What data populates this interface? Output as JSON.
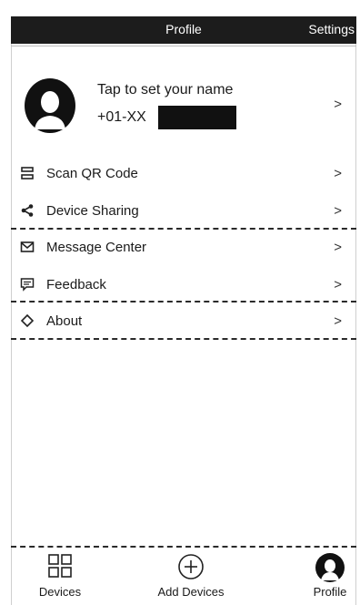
{
  "header": {
    "title": "Profile",
    "settings_label": "Settings"
  },
  "profile": {
    "name_prompt": "Tap to set your name",
    "phone_prefix": "+01-XX",
    "chevron": ">"
  },
  "menu": [
    {
      "label": "Scan QR Code",
      "icon": "scan-qr-icon",
      "chevron": ">"
    },
    {
      "label": "Device Sharing",
      "icon": "share-icon",
      "chevron": ">"
    },
    {
      "label": "Message Center",
      "icon": "mail-icon",
      "chevron": ">"
    },
    {
      "label": "Feedback",
      "icon": "feedback-icon",
      "chevron": ">"
    },
    {
      "label": "About",
      "icon": "about-icon",
      "chevron": ">"
    }
  ],
  "bottom_nav": {
    "items": [
      {
        "label": "Devices",
        "icon": "grid-icon"
      },
      {
        "label": "Add Devices",
        "icon": "add-circle-icon"
      },
      {
        "label": "Profile",
        "icon": "profile-icon",
        "active": true
      }
    ]
  }
}
